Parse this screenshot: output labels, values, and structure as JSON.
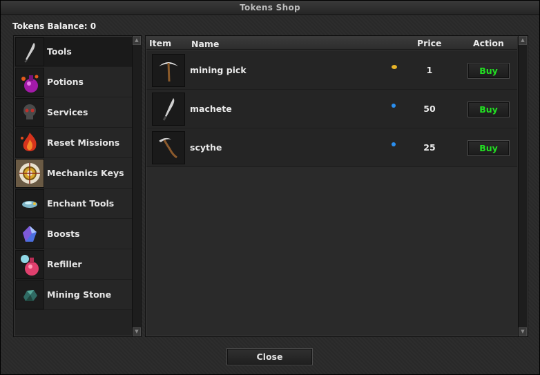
{
  "window": {
    "title": "Tokens Shop"
  },
  "balance": {
    "text": "Tokens Balance: 0"
  },
  "categories": [
    {
      "label": "Tools",
      "icon": "blade-icon",
      "active": true
    },
    {
      "label": "Potions",
      "icon": "potion-flask-icon"
    },
    {
      "label": "Services",
      "icon": "skull-icon"
    },
    {
      "label": "Reset Missions",
      "icon": "fire-icon"
    },
    {
      "label": "Mechanics Keys",
      "icon": "gear-emblem-icon"
    },
    {
      "label": "Enchant Tools",
      "icon": "enchant-gem-icon"
    },
    {
      "label": "Boosts",
      "icon": "crystal-icon"
    },
    {
      "label": "Refiller",
      "icon": "refill-flask-icon"
    },
    {
      "label": "Mining Stone",
      "icon": "stone-icon"
    }
  ],
  "table": {
    "headers": {
      "item": "Item",
      "name": "Name",
      "price": "Price",
      "action": "Action"
    },
    "rows": [
      {
        "name": "mining pick",
        "price": "1",
        "currency_color": "#e8b428",
        "icon": "pickaxe-icon",
        "action": "Buy"
      },
      {
        "name": "machete",
        "price": "50",
        "currency_color": "#2a8ff0",
        "icon": "machete-icon",
        "action": "Buy"
      },
      {
        "name": "scythe",
        "price": "25",
        "currency_color": "#2a8ff0",
        "icon": "scythe-icon",
        "action": "Buy"
      }
    ]
  },
  "footer": {
    "close_label": "Close"
  },
  "colors": {
    "buy_text": "#22e022",
    "background": "#2a2a2a"
  }
}
